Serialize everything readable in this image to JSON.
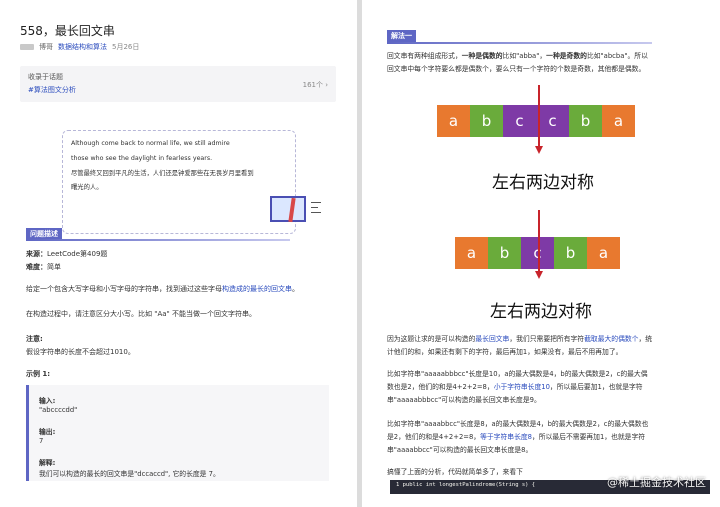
{
  "left": {
    "title": "558，最长回文串",
    "meta": {
      "author": "博哥",
      "column": "数据结构和算法",
      "date": "5月26日"
    },
    "collection": {
      "label": "收录于话题",
      "tag": "#算法图文分析",
      "count": "161个 ›"
    },
    "quote": [
      "Although come back to normal life, we still admire",
      "those who see the daylight in fearless years.",
      "尽管最终又回到平凡的生活，人们还是钟爱那些在无畏岁月里看到",
      "曙光的人。"
    ],
    "section": "问题描述",
    "source": {
      "label": "来源：",
      "value": "LeetCode第409题"
    },
    "difficulty": {
      "label": "难度：",
      "value": "简单"
    },
    "desc1": {
      "pre": "给定一个包含大写字母和小写字母的字符串，找到通过这些字母",
      "hl": "构造成的最长的回文串",
      "post": "。"
    },
    "desc2": "在构造过程中，请注意区分大小写。比如 \"Aa\" 不能当做一个回文字符串。",
    "note_label": "注意:",
    "note_text": "假设字符串的长度不会超过1010。",
    "example_label": "示例 1:",
    "example": {
      "input_label": "输入:",
      "input_value": "\"abccccdd\"",
      "output_label": "输出:",
      "output_value": "7",
      "explain_label": "解释:",
      "explain_text": "我们可以构造的最长的回文串是\"dccaccd\", 它的长度是 7。"
    }
  },
  "right": {
    "section": "解法一",
    "p1": {
      "a": "回文串有两种组成形式，",
      "b": "一种是偶数的",
      "c": "比如\"abba\"，",
      "d": "一种是奇数的",
      "e": "比如\"abcba\"。所以",
      "line2": "回文串中每个字符要么都是偶数个，要么只有一个字符的个数是奇数，其他都是偶数。"
    },
    "even_cells": [
      {
        "ch": "a",
        "color": "#e8792f"
      },
      {
        "ch": "b",
        "color": "#6aab3b"
      },
      {
        "ch": "c",
        "color": "#7e3aa6"
      },
      {
        "ch": "c",
        "color": "#7e3aa6"
      },
      {
        "ch": "b",
        "color": "#6aab3b"
      },
      {
        "ch": "a",
        "color": "#e8792f"
      }
    ],
    "odd_cells": [
      {
        "ch": "a",
        "color": "#e8792f"
      },
      {
        "ch": "b",
        "color": "#6aab3b"
      },
      {
        "ch": "c",
        "color": "#7e3aa6"
      },
      {
        "ch": "b",
        "color": "#6aab3b"
      },
      {
        "ch": "a",
        "color": "#e8792f"
      }
    ],
    "symmetric_label_1": "左右两边对称",
    "symmetric_label_2": "左右两边对称",
    "p2": {
      "a": "因为这题让求的是可以构造的",
      "b": "最长回文串",
      "c": "，我们只需要把所有字符",
      "d": "截取最大的偶数个",
      "e": "，统",
      "line2": "计他们的和，如果还有剩下的字符，最后再加1，如果没有，最后不用再加了。"
    },
    "p3": {
      "line1": "比如字符串\"aaaaabbbcc\"长度是10，a的最大偶数是4，b的最大偶数是2，c的最大偶",
      "line2a": "数也是2，他们的和是4+2+2=8，",
      "line2b": "小于字符串长度10",
      "line2c": "，所以最后要加1，也就是字符",
      "line3": "串\"aaaaabbbcc\"可以构造的最长回文串长度是9。"
    },
    "p4": {
      "line1": "比如字符串\"aaaabbcc\"长度是8，a的最大偶数是4，b的最大偶数是2，c的最大偶数也",
      "line2a": "是2，他们的和是4+2+2=8，",
      "line2b": "等于字符串长度8",
      "line2c": "，所以最后不需要再加1，也就是字符",
      "line3": "串\"aaaabbcc\"可以构造的最长回文串长度是8。"
    },
    "p5": "搞懂了上面的分析，代码就简单多了，来看下",
    "code_line": "1    public int longestPalindrome(String s) {",
    "watermark": "@稀土掘金技术社区"
  }
}
